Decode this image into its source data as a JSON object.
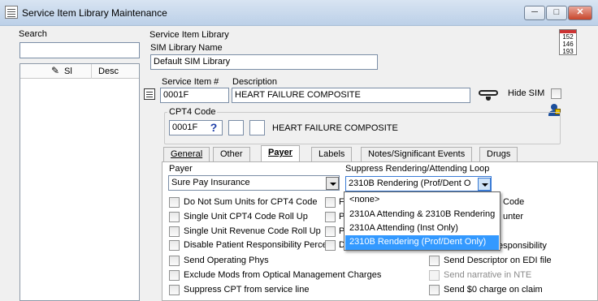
{
  "window": {
    "title": "Service Item Library Maintenance",
    "buttons": {
      "minimize": "─",
      "maximize": "□",
      "close": "✕"
    }
  },
  "search": {
    "label": "Search",
    "value": "",
    "columns": [
      "Sl",
      "Desc"
    ]
  },
  "library": {
    "group_label": "Service Item Library",
    "name_label": "SIM Library Name",
    "name_value": "Default SIM Library",
    "calendar_lines": [
      "152",
      "146",
      "193"
    ]
  },
  "item": {
    "number_label": "Service Item #",
    "number_value": "0001F",
    "description_label": "Description",
    "description_value": "HEART FAILURE COMPOSITE",
    "hide_sim_label": "Hide SIM",
    "help_char": "?"
  },
  "cpt4": {
    "label": "CPT4 Code",
    "value": "0001F",
    "description": "HEART FAILURE COMPOSITE"
  },
  "tabs": [
    {
      "label": "General"
    },
    {
      "label": "Other"
    },
    {
      "label": "Payer"
    },
    {
      "label": "Labels"
    },
    {
      "label": "Notes/Significant Events"
    },
    {
      "label": "Drugs"
    }
  ],
  "payer": {
    "payer_label": "Payer",
    "payer_value": "Sure Pay Insurance",
    "loop_label": "Suppress Rendering/Attending Loop",
    "loop_value": "2310B Rendering (Prof/Dent O",
    "options": [
      "<none>",
      "2310A Attending & 2310B Rendering",
      "2310A Attending (Inst Only)",
      "2310B Rendering (Prof/Dent Only)"
    ],
    "left_checks": [
      "Do Not Sum Units for CPT4 Code",
      "Single Unit CPT4 Code Roll Up",
      "Single Unit Revenue Code Roll Up",
      "Disable Patient Responsibility Percent",
      "Send Operating Phys",
      "Exclude Mods from Optical Management Charges",
      "Suppress CPT from service line"
    ],
    "middle_fragments": [
      "F",
      "P",
      "P",
      "D"
    ],
    "right_fragments": [
      "Code",
      "unter",
      "esponsibility"
    ],
    "right_checks": [
      "Send Descriptor on EDI file",
      "Send narrative in NTE",
      "Send $0 charge on claim"
    ]
  }
}
